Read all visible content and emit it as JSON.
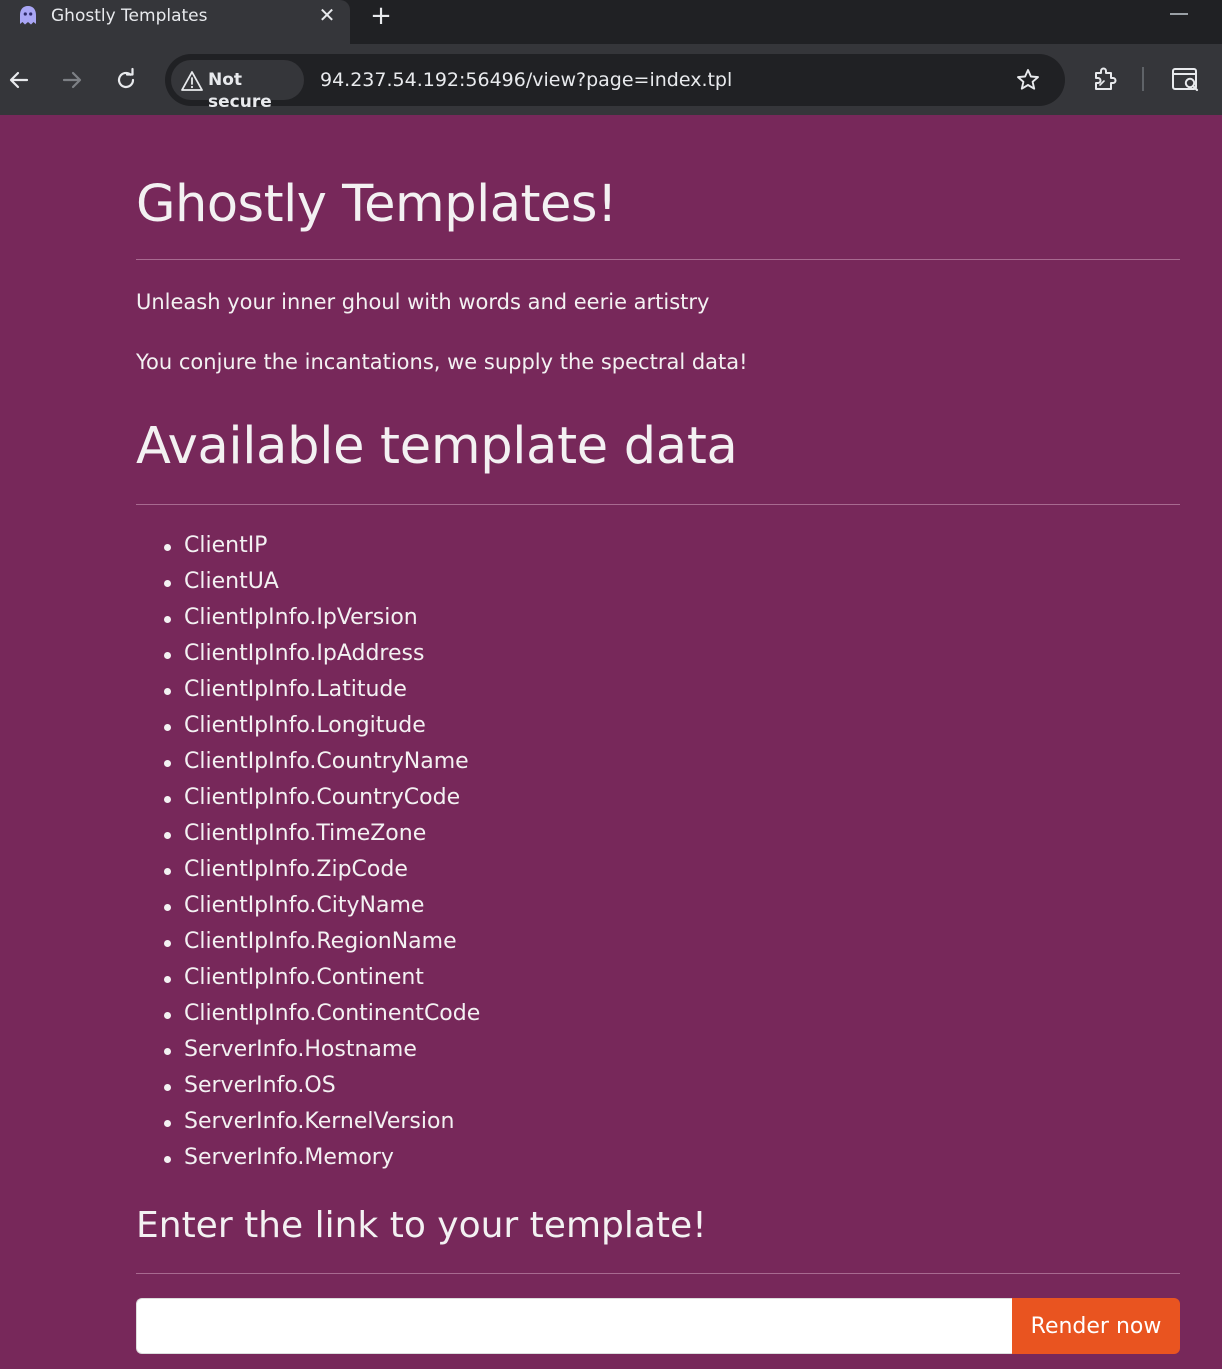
{
  "browser": {
    "tab_title": "Ghostly Templates",
    "security_label": "Not secure",
    "url": "94.237.54.192:56496/view?page=index.tpl"
  },
  "page": {
    "title": "Ghostly Templates!",
    "tagline_1": "Unleash your inner ghoul with words and eerie artistry",
    "tagline_2": "You conjure the incantations, we supply the spectral data!",
    "data_section_title": "Available template data",
    "template_fields": [
      "ClientIP",
      "ClientUA",
      "ClientIpInfo.IpVersion",
      "ClientIpInfo.IpAddress",
      "ClientIpInfo.Latitude",
      "ClientIpInfo.Longitude",
      "ClientIpInfo.CountryName",
      "ClientIpInfo.CountryCode",
      "ClientIpInfo.TimeZone",
      "ClientIpInfo.ZipCode",
      "ClientIpInfo.CityName",
      "ClientIpInfo.RegionName",
      "ClientIpInfo.Continent",
      "ClientIpInfo.ContinentCode",
      "ServerInfo.Hostname",
      "ServerInfo.OS",
      "ServerInfo.KernelVersion",
      "ServerInfo.Memory"
    ],
    "form_title": "Enter the link to your template!",
    "input_value": "",
    "render_button_label": "Render now"
  },
  "colors": {
    "page_background": "#77285a",
    "button_accent": "#e95420",
    "chrome_dark": "#202124",
    "chrome_toolbar": "#35363a"
  },
  "icons": {
    "tab_favicon": "ghost-icon",
    "tab_close": "close-icon",
    "new_tab": "plus-icon",
    "back": "back-arrow-icon",
    "forward": "forward-arrow-icon",
    "reload": "reload-icon",
    "security": "warning-triangle-icon",
    "bookmark": "star-icon",
    "extensions": "puzzle-icon",
    "lens": "search-screen-icon"
  }
}
